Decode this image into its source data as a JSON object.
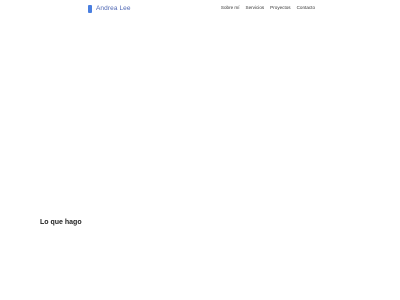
{
  "header": {
    "brand_name": "Andrea Lee",
    "brand_icon": "brand-logo-icon",
    "brand_color": "#4a7fe0",
    "nav": [
      {
        "label": "Sobre mí"
      },
      {
        "label": "Servicios"
      },
      {
        "label": "Proyectos"
      },
      {
        "label": "Contacto"
      }
    ]
  },
  "main": {
    "section_title": "Lo que hago"
  }
}
